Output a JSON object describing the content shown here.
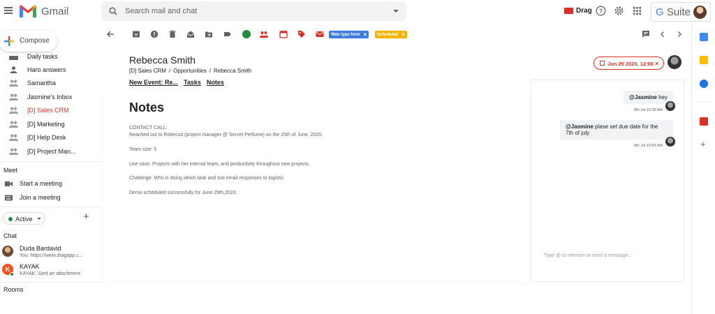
{
  "app": {
    "name": "Gmail"
  },
  "search": {
    "placeholder": "Search mail and chat"
  },
  "topbar": {
    "drag_label": "Drag",
    "gsuite_g": "G",
    "gsuite_suite": " Suite"
  },
  "compose": {
    "label": "Compose"
  },
  "sidebar": {
    "items": [
      {
        "label": "Daily tasks",
        "active": false
      },
      {
        "label": "Haro answers",
        "active": false
      },
      {
        "label": "Samantha",
        "active": false
      },
      {
        "label": "Jasmine's Inbox",
        "active": false
      },
      {
        "label": "[D] Sales CRM",
        "active": true
      },
      {
        "label": "[D] Marketing",
        "active": false
      },
      {
        "label": "[D] Help Desk",
        "active": false
      },
      {
        "label": "[D] Project Man...",
        "active": false
      }
    ],
    "meet_title": "Meet",
    "meet_items": [
      "Start a meeting",
      "Join a meeting"
    ],
    "status": "Active",
    "chat_title": "Chat",
    "chats": [
      {
        "name": "Duda Bardavid",
        "preview": "You: https://www.dragapp.c..."
      },
      {
        "name": "KAYAK",
        "preview_prefix": "KAYAK: ",
        "preview": "Sent an attachment",
        "initial": "K"
      }
    ],
    "rooms_title": "Rooms"
  },
  "toolbar": {
    "chips": [
      {
        "label": "Web type form",
        "color": "#3d7be0"
      },
      {
        "label": "Scheduled",
        "color": "#f4b400"
      }
    ]
  },
  "detail": {
    "title": "Rebecca Smith",
    "breadcrumb": [
      "[D] Sales CRM",
      "Opportunities",
      "Rebecca Smith"
    ],
    "tabs": [
      "New Event: Re...",
      "Tasks",
      "Notes"
    ],
    "due_date": "Jun 29 2020, 12:00",
    "notes": {
      "heading": "Notes",
      "lines": [
        "CONTACT CALL:",
        "Reached out to Rebecca (project manager @ Secret Perfume) on the 25th of June, 2020.",
        "Team size: 5",
        "Use case: Projects with her internal team, and productivity throughout new projects.",
        "Challenge: Who is doing which task and lost email responses to logistic.",
        "Demo scheduled successfully for June 29th,2020."
      ]
    }
  },
  "chat_panel": {
    "messages": [
      {
        "mention": "@Jasmine",
        "text": " hey",
        "time": "8th Jul 10:38 AM"
      },
      {
        "mention": "@Jasmine",
        "text": " plase set due date for the",
        "text2": "7th of july",
        "time": "8th Jul 10:43 AM"
      }
    ],
    "input_placeholder": "Type @ to mention or send a message..."
  },
  "colors": {
    "accent_red": "#d93025",
    "active_green": "#1e8e3e",
    "chip_blue": "#3d7be0",
    "chip_yellow": "#f4b400"
  }
}
